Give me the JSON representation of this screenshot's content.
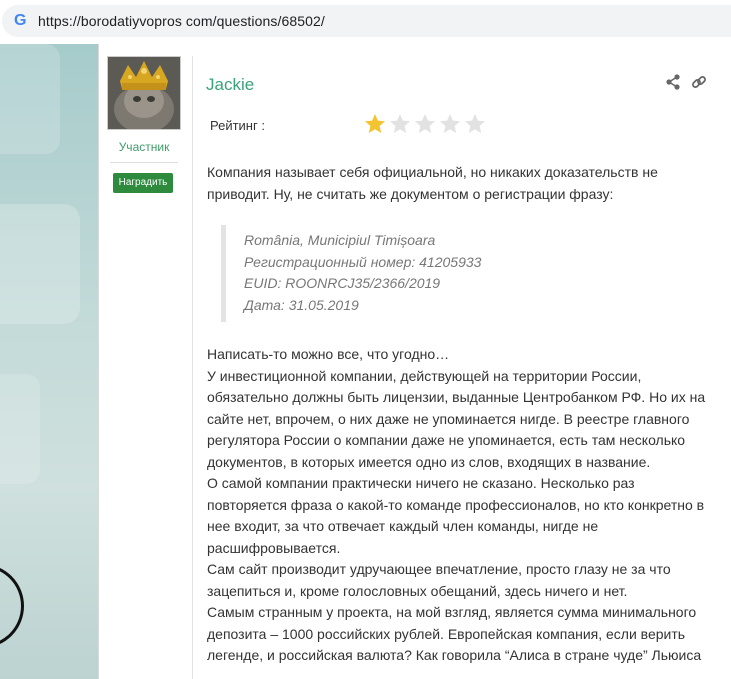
{
  "browser": {
    "url": "https://borodatiyvopros com/questions/68502/"
  },
  "user": {
    "name": "Jackie",
    "role": "Участник",
    "reward_button": "Наградить"
  },
  "rating": {
    "label": "Рейтинг :",
    "value": 1,
    "max": 5,
    "filled_color": "#f4c430",
    "empty_color": "#e2e2e2"
  },
  "post": {
    "intro": "Компания называет себя официальной, но никаких доказательств не приводит. Ну, не считать же документом о регистрации фразу:",
    "quote": [
      "România, Municipiul Timișoara",
      "Регистрационный номер: 41205933",
      "EUID: ROONRCJ35/2366/2019",
      "Дата: 31.05.2019"
    ],
    "paragraphs": [
      "Написать-то можно все, что угодно…",
      "У инвестиционной компании, действующей на территории России, обязательно должны быть лицензии, выданные Центробанком РФ. Но их на сайте нет, впрочем, о них даже не упоминается нигде. В реестре главного регулятора России о компании даже не упоминается, есть там несколько документов, в которых имеется одно из слов, входящих в название.",
      "О самой компании практически ничего не сказано. Несколько раз повторяется фраза о какой-то команде профессионалов, но кто конкретно в нее входит, за что отвечает каждый член команды, нигде не расшифровывается.",
      "Сам сайт производит удручающее впечатление, просто глазу не за что зацепиться и, кроме голословных обещаний, здесь ничего и нет.",
      "Самым странным у проекта, на мой взгляд, является сумма минимального депозита – 1000 российских рублей. Европейская компания, если верить легенде, и российская валюта? Как говорила “Алиса в стране чуде” Льюиса"
    ]
  },
  "icons": {
    "browser": "google-g-icon",
    "share": "share-icon",
    "link": "link-icon"
  },
  "colors": {
    "accent_green": "#3aa37a",
    "button_green": "#2e8b3e"
  }
}
